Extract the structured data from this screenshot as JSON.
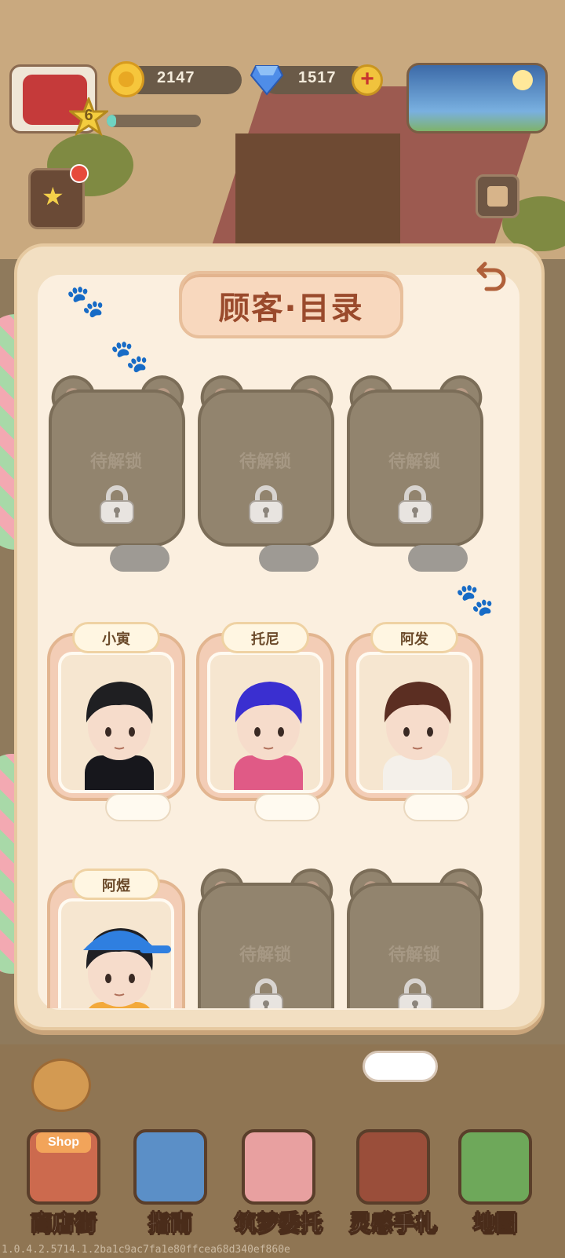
{
  "hud": {
    "level": "6",
    "xp_progress": 0.1,
    "coins": "2147",
    "gems": "1517",
    "plus_label": "+"
  },
  "panel": {
    "title": "顾客·目录",
    "back_icon": "undo-arrow-icon"
  },
  "customers": [
    {
      "unlocked": false,
      "lock_label": "待解锁"
    },
    {
      "unlocked": false,
      "lock_label": "待解锁"
    },
    {
      "unlocked": false,
      "lock_label": "待解锁"
    },
    {
      "unlocked": true,
      "name": "小寅",
      "hair": "#1f1f22",
      "shirt": "#17171c",
      "hat": ""
    },
    {
      "unlocked": true,
      "name": "托尼",
      "hair": "#3a2fd0",
      "shirt": "#e05a86",
      "hat": ""
    },
    {
      "unlocked": true,
      "name": "阿发",
      "hair": "#5b2e22",
      "shirt": "#f4f0ea",
      "hat": ""
    },
    {
      "unlocked": true,
      "name": "阿煜",
      "hair": "#202024",
      "shirt": "#f3a93a",
      "hat": "#2f7fe0"
    },
    {
      "unlocked": false,
      "lock_label": "待解锁"
    },
    {
      "unlocked": false,
      "lock_label": "待解锁"
    }
  ],
  "nav": [
    {
      "label": "商店街",
      "icon": "shop-icon",
      "sign": "Shop",
      "color": "#cc6a4e"
    },
    {
      "label": "指南",
      "icon": "guide-book-icon",
      "color": "#5b8fc7"
    },
    {
      "label": "筑梦委托",
      "icon": "commission-bag-icon",
      "color": "#e8a0a0"
    },
    {
      "label": "灵感手札",
      "icon": "notebook-quill-icon",
      "color": "#9a4e3a"
    },
    {
      "label": "地图",
      "icon": "map-pin-icon",
      "color": "#6ea85a"
    }
  ],
  "version": "1.0.4.2.5714.1.2ba1c9ac7fa1e80ffcea68d340ef860e"
}
